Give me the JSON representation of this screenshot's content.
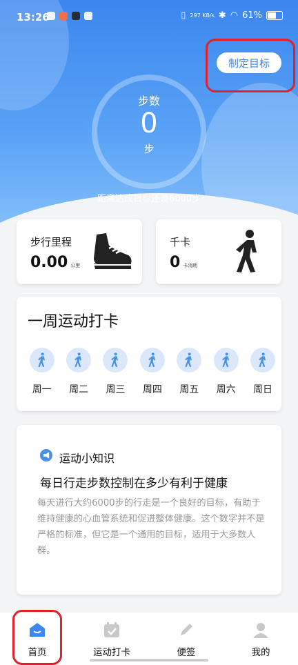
{
  "status_bar": {
    "time": "13:26",
    "speed": "297 KB/s",
    "battery": "61%"
  },
  "header": {
    "goal_button": "制定目标"
  },
  "steps": {
    "label": "步数",
    "value": "0",
    "unit": "步",
    "remaining": "距离达成目标还差6000步"
  },
  "stats": [
    {
      "title": "步行里程",
      "value": "0.00",
      "unit": "公里"
    },
    {
      "title": "千卡",
      "value": "0",
      "unit": "卡消耗"
    }
  ],
  "week": {
    "title": "一周运动打卡",
    "days": [
      "周一",
      "周二",
      "周三",
      "周四",
      "周五",
      "周六",
      "周日"
    ]
  },
  "tip": {
    "header": "运动小知识",
    "title": "每日行走步数控制在多少有利于健康",
    "body": "每天进行大约6000步的行走是一个良好的目标，有助于维持健康的心血管系统和促进整体健康。这个数字并不是严格的标准，但它是一个通用的目标，适用于大多数人群。"
  },
  "tabbar": [
    {
      "label": "首页",
      "icon": "home-icon"
    },
    {
      "label": "运动打卡",
      "icon": "calendar-check-icon"
    },
    {
      "label": "便签",
      "icon": "pencil-icon"
    },
    {
      "label": "我的",
      "icon": "user-icon"
    }
  ],
  "colors": {
    "accent": "#3b86ef",
    "highlight": "#e0202a",
    "tip_text": "#9a9a9a"
  }
}
